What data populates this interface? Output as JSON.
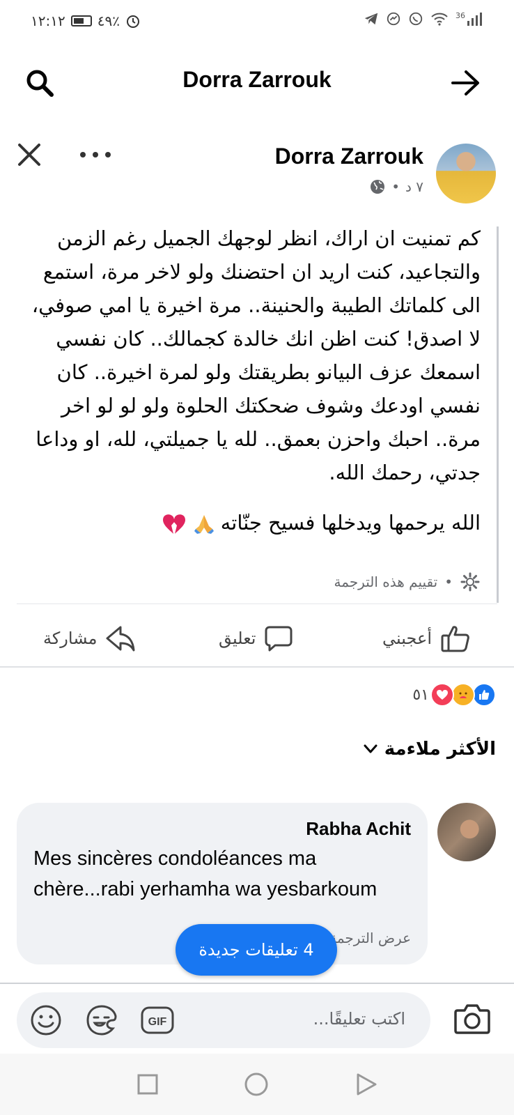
{
  "status_bar": {
    "time": "١٢:١٢",
    "battery": "٤٩٪",
    "network": "36"
  },
  "header": {
    "title": "Dorra Zarrouk"
  },
  "post": {
    "author": "Dorra Zarrouk",
    "time": "٧ د",
    "paragraph1": "كم تمنيت ان اراك، انظر لوجهك الجميل رغم الزمن والتجاعيد، كنت اريد ان احتضنك ولو لاخر مرة، استمع الى كلماتك الطيبة والحنينة.. مرة اخيرة يا امي صوفي، لا اصدق! كنت اظن انك خالدة كجمالك.. كان نفسي اسمعك عزف البيانو بطريقتك ولو لمرة اخيرة.. كان نفسي اودعك وشوف ضحكتك الحلوة ولو لو لو اخر مرة.. احبك واحزن بعمق.. لله يا جميلتي، لله، او وداعا جدتي، رحمك الله.",
    "paragraph2": "الله يرحمها ويدخلها فسيح جنّاته",
    "rate_translation": "تقييم هذه الترجمة"
  },
  "actions": {
    "like": "أعجبني",
    "comment": "تعليق",
    "share": "مشاركة"
  },
  "reactions": {
    "count": "٥١"
  },
  "sort": {
    "label": "الأكثر ملاءمة"
  },
  "comment": {
    "author": "Rabha Achit",
    "text": "Mes sincères condoléances ma chère...rabi yerhamha wa yesbarkoum",
    "translate": "عرض الترجمة"
  },
  "new_comments": {
    "label": "4 تعليقات جديدة"
  },
  "composer": {
    "placeholder": "اكتب تعليقًا..."
  },
  "colors": {
    "brand": "#1877f2",
    "heart": "#f33e58",
    "care": "#f7b125"
  }
}
